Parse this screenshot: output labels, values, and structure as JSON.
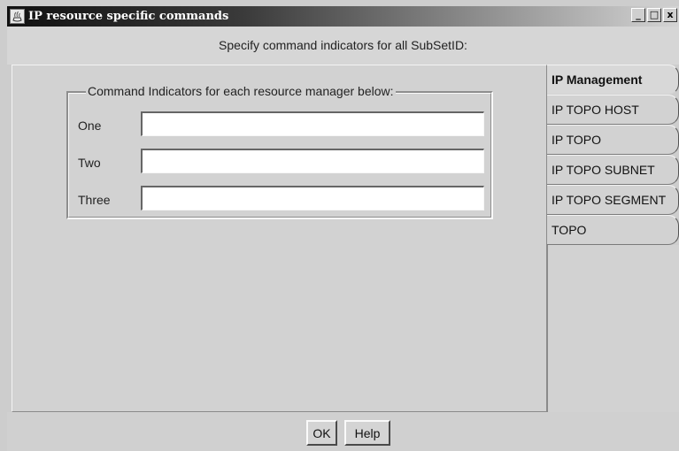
{
  "window": {
    "title": "IP resource specific commands",
    "icon": "java-app-icon",
    "controls": {
      "minimize": "_",
      "maximize": "□",
      "close": "x"
    }
  },
  "header": {
    "text": "Specify command indicators for all SubSetID:"
  },
  "group": {
    "legend": "Command Indicators for each resource manager below:",
    "rows": [
      {
        "label": "One",
        "value": ""
      },
      {
        "label": "Two",
        "value": ""
      },
      {
        "label": "Three",
        "value": ""
      }
    ]
  },
  "tabs": [
    {
      "label": "IP Management",
      "selected": true
    },
    {
      "label": "IP TOPO HOST",
      "selected": false
    },
    {
      "label": "IP TOPO",
      "selected": false
    },
    {
      "label": "IP TOPO SUBNET",
      "selected": false
    },
    {
      "label": "IP TOPO SEGMENT",
      "selected": false
    },
    {
      "label": "TOPO",
      "selected": false
    }
  ],
  "buttons": {
    "ok": "OK",
    "help": "Help"
  }
}
